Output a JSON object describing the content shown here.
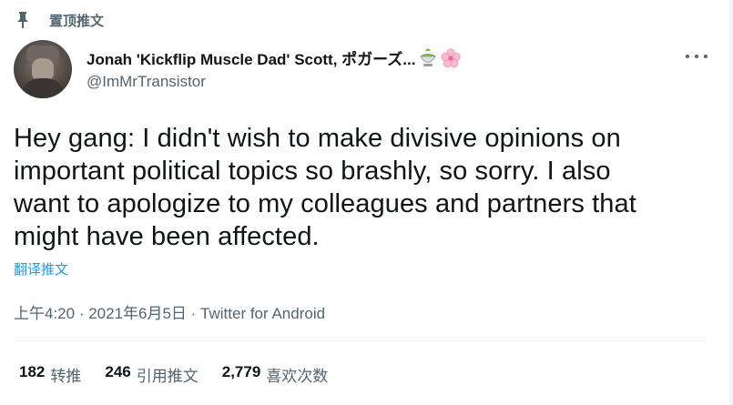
{
  "pinned": {
    "label": "置顶推文",
    "icon": "pin-icon"
  },
  "author": {
    "display_name": "Jonah 'Kickflip Muscle Dad' Scott, ポガーズ...",
    "emojis": [
      "matcha-bowl-icon",
      "cherry-blossom-icon"
    ],
    "handle": "@ImMrTransistor"
  },
  "tweet": {
    "lines": [
      "Hey gang: I didn't wish to make divisive opinions on",
      "important political topics so brashly, so sorry. I also",
      "want to apologize to my colleagues and partners that",
      "might have been affected."
    ],
    "translate_label": "翻译推文",
    "time": "上午4:20",
    "sep1": " · ",
    "date": "2021年6月5日",
    "sep2": " · ",
    "source": "Twitter for Android"
  },
  "stats": {
    "retweets": {
      "count": "182",
      "label": "转推"
    },
    "quotes": {
      "count": "246",
      "label": "引用推文"
    },
    "likes": {
      "count": "2,779",
      "label": "喜欢次数"
    }
  },
  "colors": {
    "accent": "#1d9bf0",
    "secondary": "#536471",
    "text": "#0f1419"
  }
}
